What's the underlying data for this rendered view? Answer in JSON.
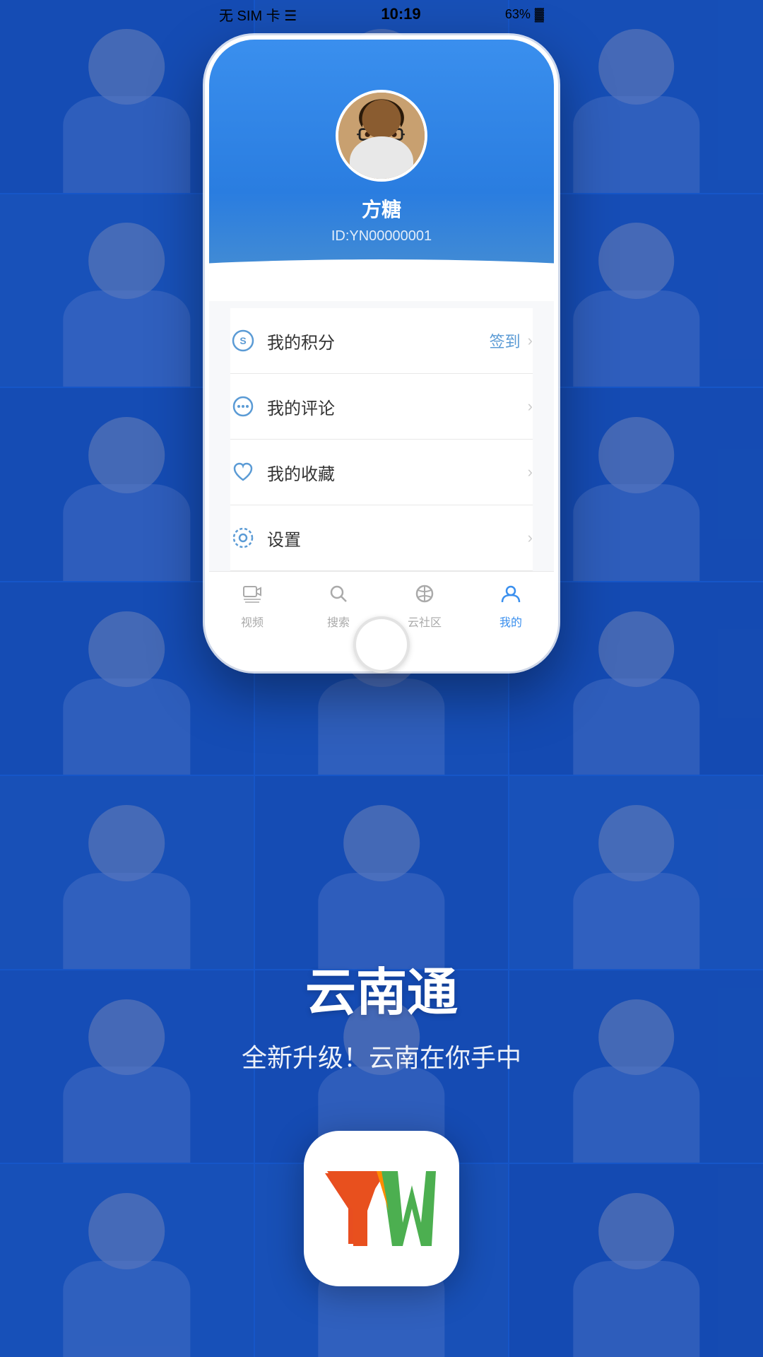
{
  "statusBar": {
    "carrier": "无 SIM 卡 ☰",
    "time": "10:19",
    "battery": "63%",
    "batteryIcon": "🔋"
  },
  "phone": {
    "user": {
      "name": "方糖",
      "id": "ID:YN00000001"
    },
    "menuItems": [
      {
        "id": "points",
        "icon": "S",
        "iconType": "points-icon",
        "label": "我的积分",
        "rightText": "签到",
        "hasChevron": true
      },
      {
        "id": "comments",
        "icon": "💬",
        "iconType": "comment-icon",
        "label": "我的评论",
        "rightText": "",
        "hasChevron": true
      },
      {
        "id": "favorites",
        "icon": "♡",
        "iconType": "heart-icon",
        "label": "我的收藏",
        "rightText": "",
        "hasChevron": true
      },
      {
        "id": "settings",
        "icon": "⚙",
        "iconType": "settings-icon",
        "label": "设置",
        "rightText": "",
        "hasChevron": true
      }
    ],
    "tabBar": [
      {
        "id": "videos",
        "label": "视频",
        "icon": "▦",
        "active": false
      },
      {
        "id": "search",
        "label": "搜索",
        "icon": "○",
        "active": false
      },
      {
        "id": "community",
        "label": "云社区",
        "icon": "◎",
        "active": false
      },
      {
        "id": "mine",
        "label": "我的",
        "icon": "👤",
        "active": true
      }
    ]
  },
  "appPromo": {
    "title": "云南通",
    "subtitle": "全新升级！云南在你手中"
  },
  "bgColors": [
    "#1a4a7a",
    "#2a5a8a",
    "#1e5585",
    "#2b6090",
    "#184070",
    "#234d82",
    "#1c4878",
    "#265d8c",
    "#1a4575",
    "#1d4d80",
    "#235888",
    "#196a6a",
    "#1f5280",
    "#2a6098",
    "#1b4d7a",
    "#245585",
    "#1a4070",
    "#206090",
    "#1e5080",
    "#286095",
    "#1a4878"
  ]
}
